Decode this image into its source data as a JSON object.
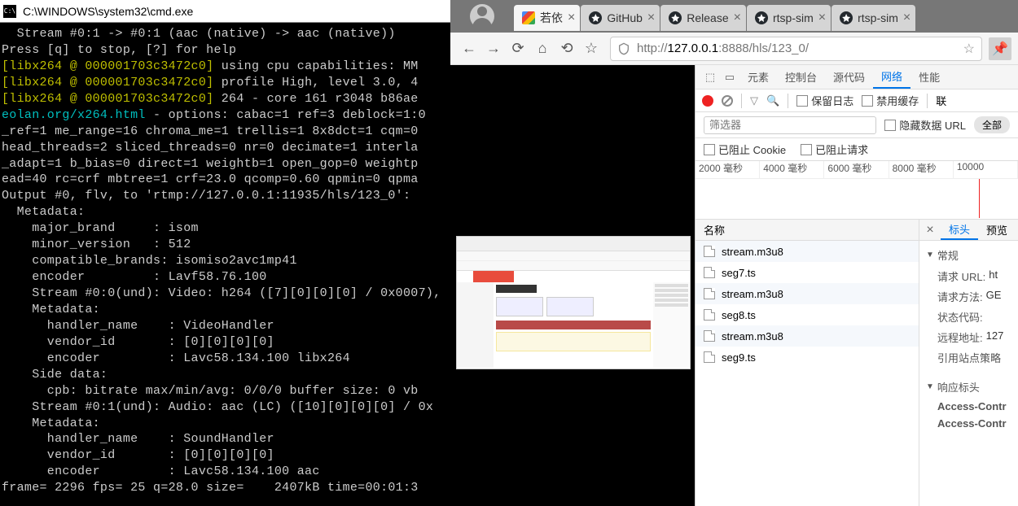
{
  "terminal": {
    "title": "C:\\WINDOWS\\system32\\cmd.exe",
    "lines": [
      {
        "segs": [
          {
            "t": "  Stream #0:1 -> #0:1 (aac (native) -> aac (native))",
            "c": ""
          }
        ]
      },
      {
        "segs": [
          {
            "t": "Press [q] to stop, [?] for help",
            "c": ""
          }
        ]
      },
      {
        "segs": [
          {
            "t": "[libx264 @ 000001703c3472c0]",
            "c": "yellow"
          },
          {
            "t": " using cpu capabilities: MM",
            "c": ""
          }
        ]
      },
      {
        "segs": [
          {
            "t": "[libx264 @ 000001703c3472c0]",
            "c": "yellow"
          },
          {
            "t": " profile High, level 3.0, 4",
            "c": ""
          }
        ]
      },
      {
        "segs": [
          {
            "t": "[libx264 @ 000001703c3472c0]",
            "c": "yellow"
          },
          {
            "t": " 264 - core 161 r3048 b86ae",
            "c": ""
          }
        ]
      },
      {
        "segs": [
          {
            "t": "eolan.org/x264.html",
            "c": "cyan"
          },
          {
            "t": " - options: cabac=1 ref=3 deblock=1:0",
            "c": ""
          }
        ]
      },
      {
        "segs": [
          {
            "t": "_ref=1 me_range=16 chroma_me=1 trellis=1 8x8dct=1 cqm=0",
            "c": ""
          }
        ]
      },
      {
        "segs": [
          {
            "t": "head_threads=2 sliced_threads=0 nr=0 decimate=1 interla",
            "c": ""
          }
        ]
      },
      {
        "segs": [
          {
            "t": "_adapt=1 b_bias=0 direct=1 weightb=1 open_gop=0 weightp",
            "c": ""
          }
        ]
      },
      {
        "segs": [
          {
            "t": "ead=40 rc=crf mbtree=1 crf=23.0 qcomp=0.60 qpmin=0 qpma",
            "c": ""
          }
        ]
      },
      {
        "segs": [
          {
            "t": "Output #0, flv, to 'rtmp://127.0.0.1:11935/hls/123_0':",
            "c": ""
          }
        ]
      },
      {
        "segs": [
          {
            "t": "  Metadata:",
            "c": ""
          }
        ]
      },
      {
        "segs": [
          {
            "t": "    major_brand     : isom",
            "c": ""
          }
        ]
      },
      {
        "segs": [
          {
            "t": "    minor_version   : 512",
            "c": ""
          }
        ]
      },
      {
        "segs": [
          {
            "t": "    compatible_brands: isomiso2avc1mp41",
            "c": ""
          }
        ]
      },
      {
        "segs": [
          {
            "t": "    encoder         : Lavf58.76.100",
            "c": ""
          }
        ]
      },
      {
        "segs": [
          {
            "t": "    Stream #0:0(und): Video: h264 ([7][0][0][0] / 0x0007),",
            "c": ""
          }
        ]
      },
      {
        "segs": [
          {
            "t": "",
            "c": ""
          }
        ]
      },
      {
        "segs": [
          {
            "t": "    Metadata:",
            "c": ""
          }
        ]
      },
      {
        "segs": [
          {
            "t": "      handler_name    : VideoHandler",
            "c": ""
          }
        ]
      },
      {
        "segs": [
          {
            "t": "      vendor_id       : [0][0][0][0]",
            "c": ""
          }
        ]
      },
      {
        "segs": [
          {
            "t": "      encoder         : Lavc58.134.100 libx264",
            "c": ""
          }
        ]
      },
      {
        "segs": [
          {
            "t": "    Side data:",
            "c": ""
          }
        ]
      },
      {
        "segs": [
          {
            "t": "      cpb: bitrate max/min/avg: 0/0/0 buffer size: 0 vb",
            "c": ""
          }
        ]
      },
      {
        "segs": [
          {
            "t": "    Stream #0:1(und): Audio: aac (LC) ([10][0][0][0] / 0x",
            "c": ""
          }
        ]
      },
      {
        "segs": [
          {
            "t": "    Metadata:",
            "c": ""
          }
        ]
      },
      {
        "segs": [
          {
            "t": "      handler_name    : SoundHandler",
            "c": ""
          }
        ]
      },
      {
        "segs": [
          {
            "t": "      vendor_id       : [0][0][0][0]",
            "c": ""
          }
        ]
      },
      {
        "segs": [
          {
            "t": "      encoder         : Lavc58.134.100 aac",
            "c": ""
          }
        ]
      },
      {
        "segs": [
          {
            "t": "frame= 2296 fps= 25 q=28.0 size=    2407kB time=00:01:3",
            "c": ""
          }
        ]
      }
    ]
  },
  "browser": {
    "tabs": [
      {
        "label": "若依",
        "type": "green",
        "active": true
      },
      {
        "label": "GitHub",
        "type": "github",
        "active": false
      },
      {
        "label": "Release",
        "type": "github",
        "active": false
      },
      {
        "label": "rtsp-sim",
        "type": "github",
        "active": false
      },
      {
        "label": "rtsp-sim",
        "type": "github",
        "active": false
      }
    ],
    "url": {
      "prefix": "http://",
      "host": "127.0.0.1",
      "rest": ":8888/hls/123_0/"
    }
  },
  "devtools": {
    "main_tabs": [
      "元素",
      "控制台",
      "源代码",
      "网络",
      "性能"
    ],
    "main_active": 3,
    "toolbar_checks": [
      {
        "label": "保留日志"
      },
      {
        "label": "禁用缓存"
      }
    ],
    "toolbar_link": "联",
    "filter_placeholder": "筛选器",
    "hide_urls_label": "隐藏数据 URL",
    "all_pill": "全部",
    "cookie_row": [
      {
        "label": "已阻止 Cookie"
      },
      {
        "label": "已阻止请求"
      }
    ],
    "timeline": [
      "2000 毫秒",
      "4000 毫秒",
      "6000 毫秒",
      "8000 毫秒",
      "10000"
    ],
    "list_head": "名称",
    "files": [
      "stream.m3u8",
      "seg7.ts",
      "stream.m3u8",
      "seg8.ts",
      "stream.m3u8",
      "seg9.ts"
    ],
    "detail_tabs": [
      "标头",
      "预览"
    ],
    "detail_active": 0,
    "sections": {
      "general": "常规",
      "kv": [
        {
          "k": "请求 URL:",
          "v": "ht"
        },
        {
          "k": "请求方法:",
          "v": "GE"
        },
        {
          "k": "状态代码:",
          "v": ""
        },
        {
          "k": "远程地址:",
          "v": "127"
        },
        {
          "k": "引用站点策略",
          "v": ""
        }
      ],
      "response_headers": "响应标头",
      "resp_kv": [
        {
          "k": "Access-Contr",
          "v": ""
        },
        {
          "k": "Access-Contr",
          "v": ""
        }
      ]
    }
  }
}
